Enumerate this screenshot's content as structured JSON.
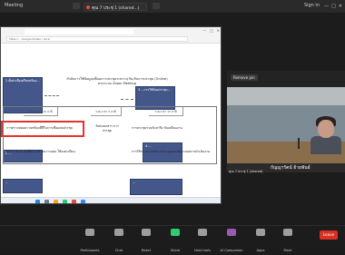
{
  "app": {
    "title": "Meeting"
  },
  "share": {
    "label": "คุณ 7 ประชุ่ 1 (shared...)"
  },
  "topbar": {
    "signin": "Sign in"
  },
  "browser": {
    "url": "https://... (Google Sheets / docs)"
  },
  "doc": {
    "title_line1": "ลำดับการใช้ข้อมูล/เพื่อนการประชุมระหว่าง(กัน)กับการประชุม (Online)",
    "title_line2": "ผ่านระบบ Zoom Meeting"
  },
  "callouts": {
    "left1": "1 ตั้งค่าเพื่อเตรียมพร้อม...",
    "right1": "3 ...การใช้ห้องประชุม...",
    "left2": "2 ...",
    "right2": "4 ...",
    "bottom_left": "...",
    "bottom_right": "..."
  },
  "table": {
    "header_left": "ระยะเวลา / 10 นาที",
    "header_mid": "ระยะเวลา 5 นาที",
    "header_right": "ระยะเวลา 15 นาที",
    "row1_left": "การตรวจสอบความพร้อมที่สี่ในการเชื่อมต่อประชุม",
    "row1_mid": "รับส่งเอกสาร การประชุม",
    "row1_right": "การประชุมร่วมกันหารือ ขับเคลื่อนงาน",
    "row2_left": "ผู้เข้าร่วมประชุมที่ยังไม่ได้ร่วมวางแผน ให้ลงทะเบียน",
    "row2_right": "การใช้ระบบการจัดการประชุมและติดตามผลการดำเนินงาน"
  },
  "video": {
    "rename_label": "Remove pin",
    "name_thai": "กัญญารัตน์ ย้ายพันธ์",
    "sub_label": "คุณ 7 ประชุ่ 1 (shared)"
  },
  "controls": {
    "participants": "Participants",
    "chat": "Chat",
    "react": "React",
    "share": "Share",
    "host_tools": "Host tools",
    "ai_companion": "AI Companion",
    "apps": "Apps",
    "more": "More",
    "leave": "Leave"
  },
  "colors": {
    "callout": "#43578a",
    "redbox": "#e5322d",
    "end": "#d93025"
  }
}
